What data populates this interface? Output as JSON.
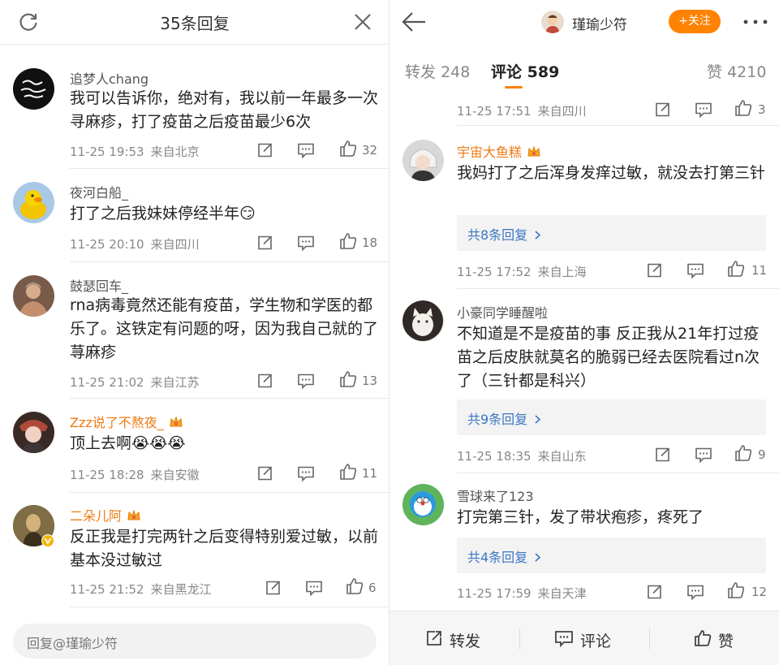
{
  "left_panel": {
    "title": "35条回复",
    "reply_placeholder": "回复@瑾瑜少符",
    "comments": [
      {
        "user": "追梦人chang",
        "text": "我可以告诉你，绝对有，我以前一年最多一次寻麻疹，打了疫苗之后疫苗最少6次",
        "date": "11-25 19:53",
        "location": "来自北京",
        "likes": "32"
      },
      {
        "user": "夜河白船_",
        "text": "打了之后我妹妹停经半年😏",
        "date": "11-25 20:10",
        "location": "来自四川",
        "likes": "18"
      },
      {
        "user": "鼓瑟回车_",
        "text": "rna病毒竟然还能有疫苗，学生物和学医的都乐了。这铁定有问题的呀，因为我自己就的了荨麻疹",
        "date": "11-25 21:02",
        "location": "来自江苏",
        "likes": "13"
      },
      {
        "user": "Zzz说了不熬夜_",
        "text": "顶上去啊😭😭😭",
        "date": "11-25 18:28",
        "location": "来自安徽",
        "likes": "11"
      },
      {
        "user": "二朵儿阿",
        "text": "反正我是打完两针之后变得特别爱过敏，以前基本没过敏过",
        "date": "11-25 21:52",
        "location": "来自黑龙江",
        "likes": "6"
      }
    ]
  },
  "right_panel": {
    "author": "瑾瑜少符",
    "follow_label": "+关注",
    "tabs": [
      {
        "label": "转发",
        "count": "248"
      },
      {
        "label": "评论",
        "count": "589"
      },
      {
        "label": "赞",
        "count": "4210"
      }
    ],
    "top_meta": {
      "date": "11-25 17:51",
      "location": "来自四川",
      "likes": "3"
    },
    "comments": [
      {
        "user": "宇宙大鱼糕",
        "text": "我妈打了之后浑身发痒过敏，就没去打第三针",
        "replies": "共8条回复",
        "date": "11-25 17:52",
        "location": "来自上海",
        "likes": "11"
      },
      {
        "user": "小豪同学睡醒啦",
        "text": "不知道是不是疫苗的事 反正我从21年打过疫苗之后皮肤就莫名的脆弱已经去医院看过n次了（三针都是科兴）",
        "replies": "共9条回复",
        "date": "11-25 18:35",
        "location": "来自山东",
        "likes": "9"
      },
      {
        "user": "雪球来了123",
        "text": "打完第三针，发了带状疱疹，疼死了",
        "replies": "共4条回复",
        "date": "11-25 17:59",
        "location": "来自天津",
        "likes": "12"
      }
    ],
    "bottom_bar": {
      "repost": "转发",
      "comment": "评论",
      "like": "赞"
    },
    "colors": {
      "accent": "#ff8200",
      "link": "#3b77c2",
      "vip_name": "#ee7a13"
    }
  }
}
